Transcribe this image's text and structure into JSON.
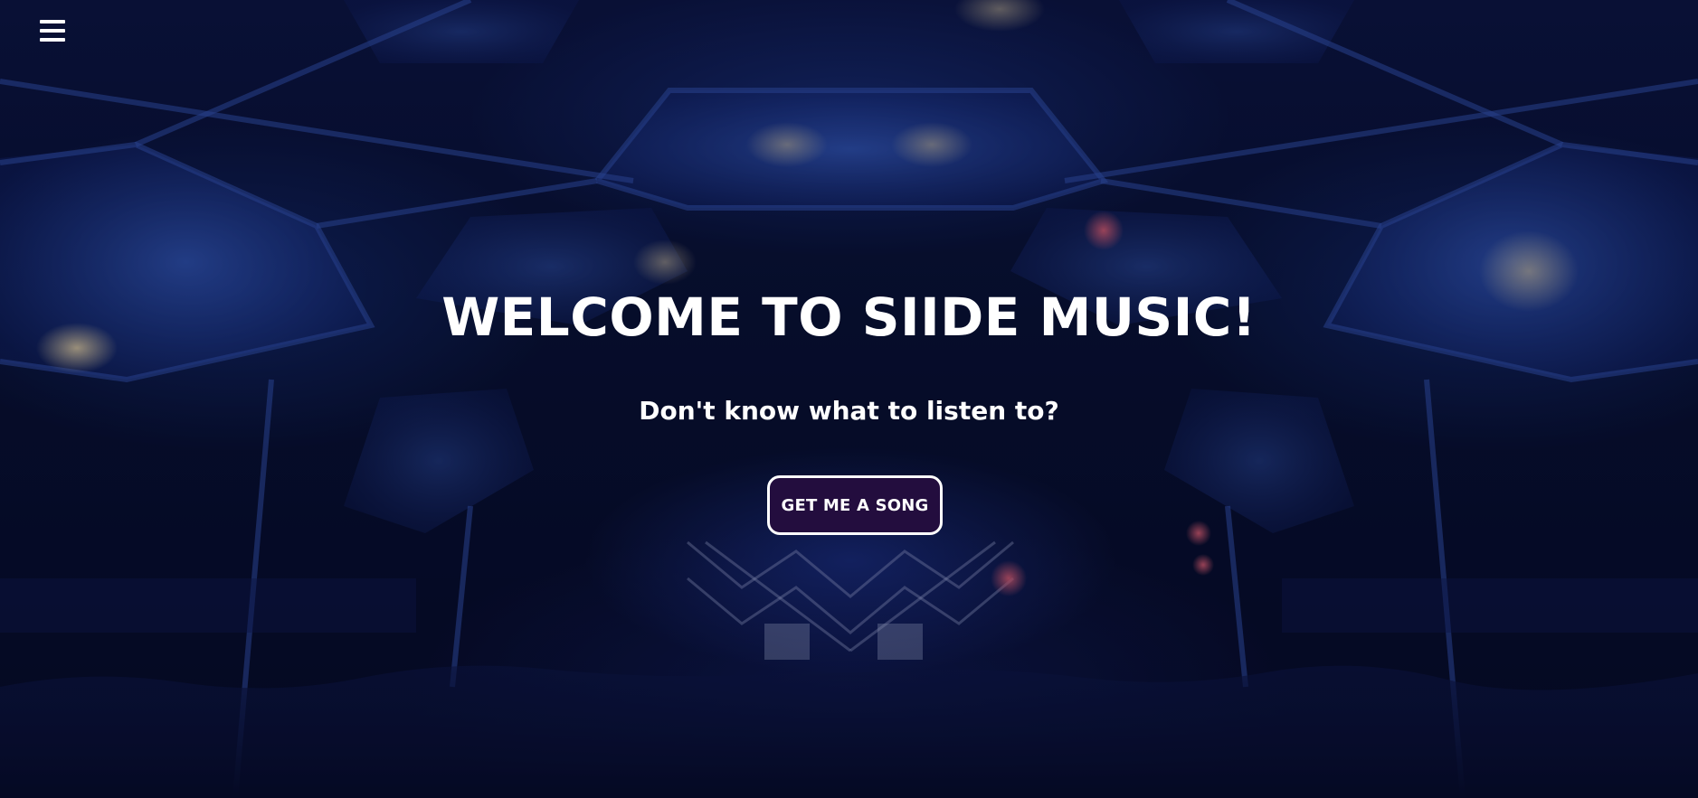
{
  "menu": {
    "icon": "hamburger-menu-icon"
  },
  "hero": {
    "title": "WELCOME TO SIIDE MUSIC!",
    "subtitle": "Don't know what to listen to?",
    "cta_label": "GET ME A SONG",
    "background_description_colors": {
      "base": "#07102f",
      "accent": "#2a4bc0",
      "button_fill": "#230d3e",
      "button_border": "#ffffff",
      "text": "#ffffff"
    }
  }
}
